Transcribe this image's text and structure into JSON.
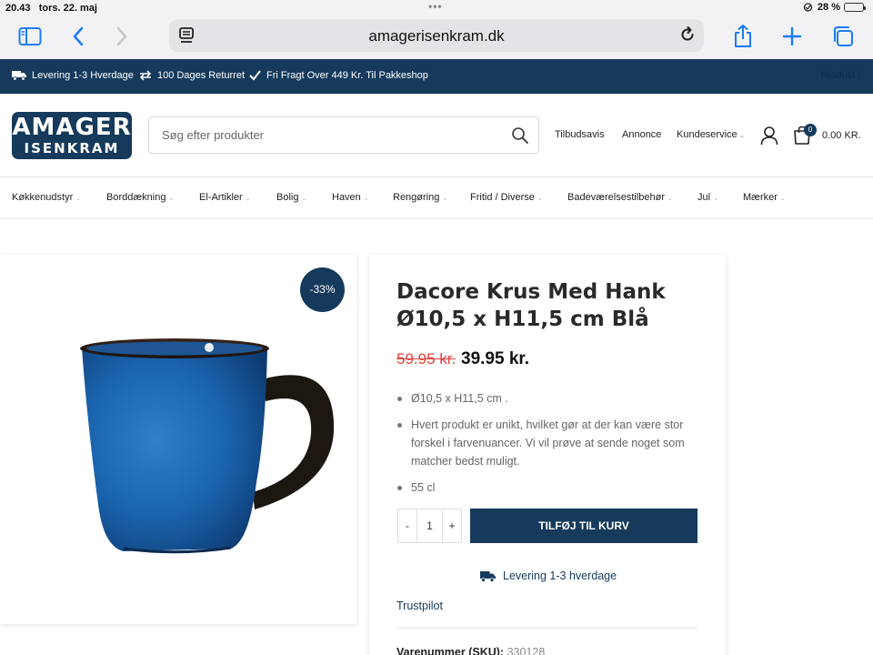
{
  "status_bar": {
    "time": "20.43",
    "date": "tors. 22. maj",
    "battery": "28 %",
    "battery_level": 0.28
  },
  "browser": {
    "url": "amagerisenkram.dk"
  },
  "info_bar": {
    "items": [
      {
        "icon": "truck-icon",
        "label": "Levering 1-3 Hverdage"
      },
      {
        "icon": "exchange-arrows-icon",
        "label": "100 Dages Returret"
      },
      {
        "icon": "checkmark-icon",
        "label": "Fri Fragt Over 449 Kr. Til Pakkeshop"
      }
    ],
    "right_text": "Produkt i"
  },
  "header": {
    "logo_line1": "AMAGER",
    "logo_line2": "ISENKRAM",
    "search_placeholder": "Søg efter produkter",
    "links": [
      "Tilbudsavis",
      "Annonce",
      "Kundeservice"
    ],
    "cart_count": "0",
    "cart_total": "0.00 KR."
  },
  "categories": [
    "Køkkenudstyr",
    "Borddækning",
    "El-Artikler",
    "Bolig",
    "Haven",
    "Rengøring",
    "Fritid / Diverse",
    "Badeværelsestilbehør",
    "Jul",
    "Mærker"
  ],
  "product": {
    "discount_badge": "-33%",
    "title": "Dacore Krus Med Hank Ø10,5 x H11,5 cm Blå",
    "old_price": "59.95 kr.",
    "price": "39.95 kr.",
    "bullets": [
      "Ø10,5 x H11,5 cm .",
      "Hvert produkt er unikt, hvilket gør at der kan være stor forskel i farvenuancer. Vi vil prøve at sende noget som matcher bedst muligt.",
      "55 cl"
    ],
    "qty_minus": "-",
    "qty_value": "1",
    "qty_plus": "+",
    "add_to_cart": "TILFØJ TIL KURV",
    "delivery": "Levering 1-3 hverdage",
    "trustpilot": "Trustpilot",
    "sku_label": "Varenummer (SKU):",
    "sku_value": "330128"
  },
  "colors": {
    "brand": "#153a5c",
    "sale": "#e0403a",
    "safari_blue": "#1a7cf5"
  }
}
